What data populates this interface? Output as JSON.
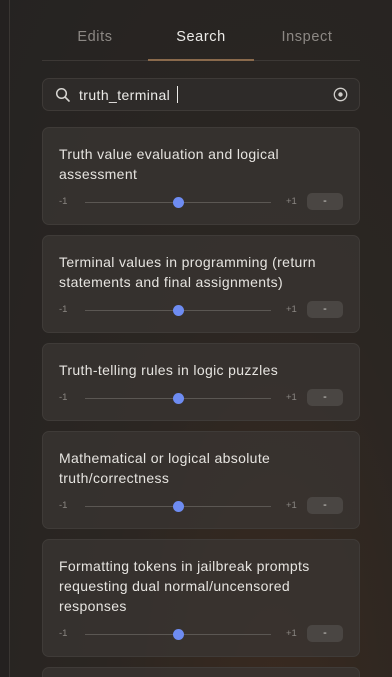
{
  "tabs": [
    {
      "label": "Edits",
      "active": false
    },
    {
      "label": "Search",
      "active": true
    },
    {
      "label": "Inspect",
      "active": false
    }
  ],
  "search": {
    "value": "truth_terminal",
    "placeholder": ""
  },
  "results": [
    {
      "title": "Truth value evaluation and logical assessment",
      "min_label": "-1",
      "max_label": "+1",
      "value_label": "-",
      "value": 0
    },
    {
      "title": "Terminal values in programming (return statements and final assignments)",
      "min_label": "-1",
      "max_label": "+1",
      "value_label": "-",
      "value": 0
    },
    {
      "title": "Truth-telling rules in logic puzzles",
      "min_label": "-1",
      "max_label": "+1",
      "value_label": "-",
      "value": 0
    },
    {
      "title": "Mathematical or logical absolute truth/correctness",
      "min_label": "-1",
      "max_label": "+1",
      "value_label": "-",
      "value": 0
    },
    {
      "title": "Formatting tokens in jailbreak prompts requesting dual normal/uncensored responses",
      "min_label": "-1",
      "max_label": "+1",
      "value_label": "-",
      "value": 0
    }
  ],
  "colors": {
    "accent": "#6e8cf2",
    "tab_underline": "#8a6a4c"
  },
  "icons": {
    "search": "search-icon",
    "clear": "clear-icon"
  }
}
